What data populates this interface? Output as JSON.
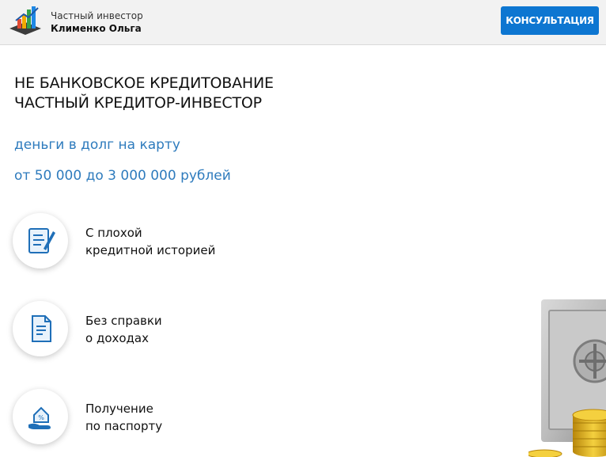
{
  "header": {
    "brand_line1": "Частный инвестор",
    "brand_line2": "Клименко Ольга",
    "consult_label": "КОНСУЛЬТАЦИЯ"
  },
  "hero": {
    "title_line1": "НЕ БАНКОВСКОЕ КРЕДИТОВАНИЕ",
    "title_line2": "ЧАСТНЫЙ КРЕДИТОР-ИНВЕСТОР",
    "subtitle1": "деньги в долг на карту",
    "subtitle2": "от 50 000 до 3 000 000 рублей"
  },
  "features": [
    {
      "icon": "document-pen-icon",
      "line1": "С плохой",
      "line2": "кредитной историей"
    },
    {
      "icon": "document-icon",
      "line1": "Без справки",
      "line2": "о доходах"
    },
    {
      "icon": "house-hand-icon",
      "line1": "Получение",
      "line2": "по паспорту"
    }
  ],
  "colors": {
    "accent": "#0d76d1",
    "subtitle": "#2e7bbd",
    "header_bg": "#f2f2f2"
  }
}
